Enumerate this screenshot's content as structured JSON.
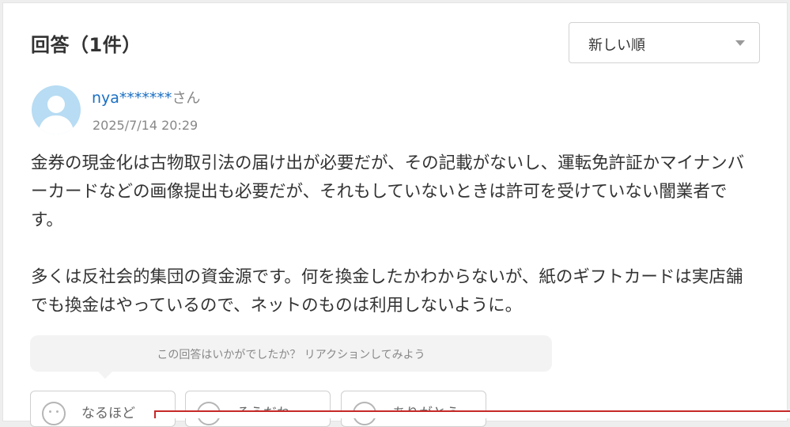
{
  "header": {
    "title": "回答（1件）"
  },
  "sort": {
    "selected": "新しい順"
  },
  "answer": {
    "user_name": "nya*******",
    "user_suffix": "さん",
    "date": "2025/7/14 20:29",
    "paragraph1": "金券の現金化は古物取引法の届け出が必要だが、その記載がないし、運転免許証かマイナンバーカードなどの画像提出も必要だが、それもしていないときは許可を受けていない闇業者です。",
    "paragraph2": "多くは反社会的集団の資金源です。何を換金したかわからないが、紙のギフトカードは実店舗でも換金はやっているので、ネットのものは利用しないように。"
  },
  "reactions": {
    "prompt": "この回答はいかがでしたか？ リアクションしてみよう",
    "buttons": [
      {
        "label": "なるほど",
        "icon": "face-icon"
      },
      {
        "label": "そうだね",
        "icon": "face-icon"
      },
      {
        "label": "ありがとう",
        "icon": "face-icon"
      }
    ]
  },
  "colors": {
    "user_link": "#1a6fc4",
    "avatar_bg": "#b7dcf3",
    "overlay_border": "#c62828"
  }
}
